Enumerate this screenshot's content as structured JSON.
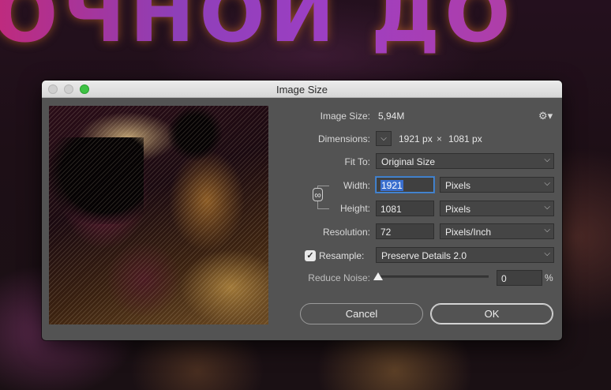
{
  "window": {
    "title": "Image Size"
  },
  "background": {
    "banner_text": "ОЧНОЙ ДО"
  },
  "image_size": {
    "label": "Image Size:",
    "value": "5,94M"
  },
  "dimensions": {
    "label": "Dimensions:",
    "width_value": "1921 px",
    "times": "×",
    "height_value": "1081 px"
  },
  "fit_to": {
    "label": "Fit To:",
    "selected": "Original Size"
  },
  "width": {
    "label": "Width:",
    "value": "1921",
    "unit": "Pixels"
  },
  "height": {
    "label": "Height:",
    "value": "1081",
    "unit": "Pixels"
  },
  "resolution": {
    "label": "Resolution:",
    "value": "72",
    "unit": "Pixels/Inch"
  },
  "resample": {
    "label": "Resample:",
    "checked": true,
    "selected": "Preserve Details 2.0"
  },
  "reduce_noise": {
    "label": "Reduce Noise:",
    "value": "0",
    "unit": "%"
  },
  "buttons": {
    "cancel": "Cancel",
    "ok": "OK"
  },
  "icons": {
    "gear": "gear-icon",
    "chain": "chain-link-icon",
    "chevron": "chevron-down-icon",
    "check": "checkmark-icon"
  },
  "colors": {
    "dialog_bg": "#535353",
    "accent_focus": "#4a8bd6",
    "maximize_green": "#3ec244"
  }
}
